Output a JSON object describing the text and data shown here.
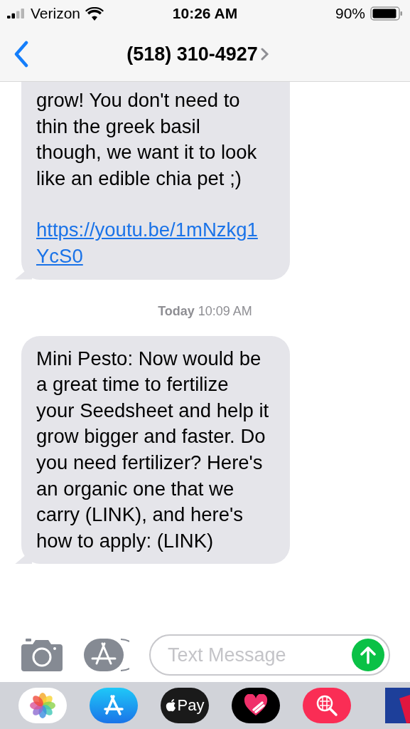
{
  "status_bar": {
    "carrier": "Verizon",
    "time": "10:26 AM",
    "battery": "90%"
  },
  "header": {
    "title": "(518) 310-4927"
  },
  "messages": [
    {
      "kind": "bubble",
      "continued": true,
      "text": "grow! You don't need to thin the greek basil though, we want it to look like an edible chia pet ;)",
      "link": "https://youtu.be/1mNzkg1YcS0"
    },
    {
      "kind": "timestamp",
      "day": "Today",
      "time": "10:09 AM"
    },
    {
      "kind": "bubble",
      "continued": false,
      "text": "Mini Pesto: Now would be a great time to fertilize your Seedsheet and help it grow bigger and faster. Do you need fertilizer? Here's an organic one that we carry (LINK), and here's how to apply: (LINK)"
    }
  ],
  "composer": {
    "placeholder": "Text Message"
  },
  "dock": [
    {
      "kind": "photos"
    },
    {
      "kind": "appstore"
    },
    {
      "kind": "pay",
      "label": "Pay"
    },
    {
      "kind": "heart"
    },
    {
      "kind": "search"
    },
    {
      "kind": "partial"
    }
  ]
}
